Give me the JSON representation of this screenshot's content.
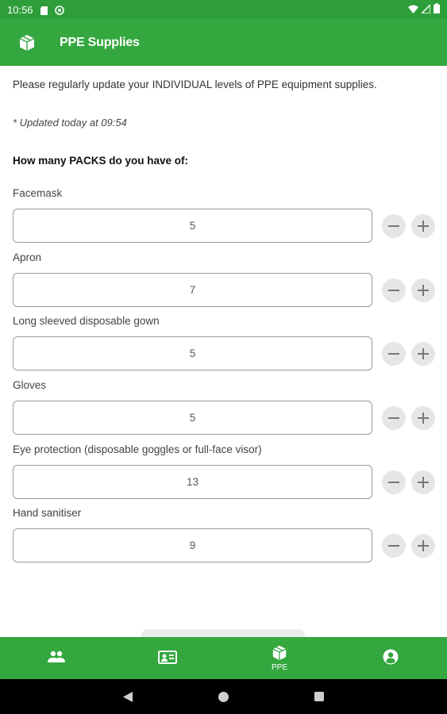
{
  "status_bar": {
    "time": "10:56"
  },
  "app_bar": {
    "title": "PPE Supplies",
    "icon": "package-icon"
  },
  "intro_text": "Please regularly update your INDIVIDUAL levels of PPE equipment supplies.",
  "updated_text": "* Updated today at 09:54",
  "question_text": "How many PACKS do you have of:",
  "items": [
    {
      "label": "Facemask",
      "value": "5"
    },
    {
      "label": "Apron",
      "value": "7"
    },
    {
      "label": "Long sleeved disposable gown",
      "value": "5"
    },
    {
      "label": "Gloves",
      "value": "5"
    },
    {
      "label": "Eye protection (disposable goggles or full-face visor)",
      "value": "13"
    },
    {
      "label": "Hand sanitiser",
      "value": "9"
    }
  ],
  "bottom_nav": {
    "items": [
      {
        "icon": "people-icon",
        "label": ""
      },
      {
        "icon": "id-card-icon",
        "label": ""
      },
      {
        "icon": "package-icon",
        "label": "PPE"
      },
      {
        "icon": "account-icon",
        "label": ""
      }
    ]
  },
  "colors": {
    "primary": "#34a73f",
    "status_bar": "#2e9e3b"
  }
}
